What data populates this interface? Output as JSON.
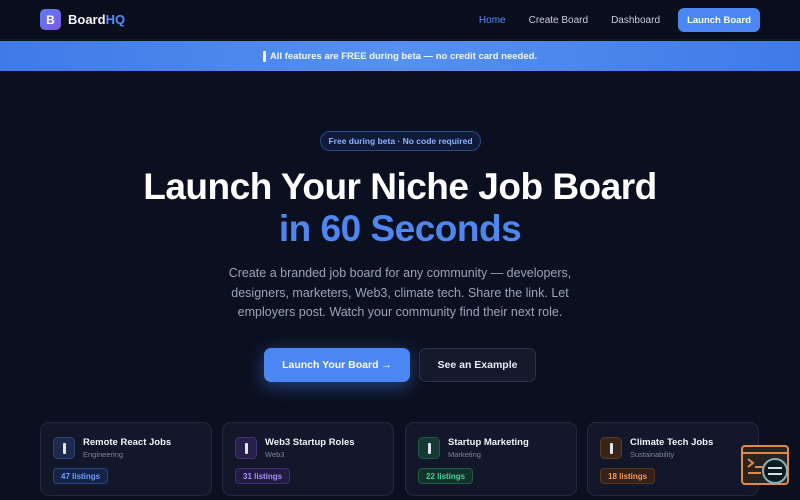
{
  "nav": {
    "logo_letter": "B",
    "brand_main": "Board",
    "brand_accent": "HQ",
    "links": [
      {
        "label": "Home",
        "active": true
      },
      {
        "label": "Create Board",
        "active": false
      },
      {
        "label": "Dashboard",
        "active": false
      }
    ],
    "cta_label": "Launch Board"
  },
  "banner": {
    "text": "All features are FREE during beta — no credit card needed."
  },
  "hero": {
    "pill": "Free during beta · No code required",
    "title_line1": "Launch Your Niche Job Board",
    "title_line2": "in 60 Seconds",
    "subtitle": "Create a branded job board for any community — developers, designers, marketers, Web3, climate tech. Share the link. Let employers post. Watch your community find their next role.",
    "primary_button": "Launch Your Board →",
    "secondary_button": "See an Example"
  },
  "cards": [
    {
      "title": "Remote React Jobs",
      "category": "Engineering",
      "listings": "47 listings",
      "color": "#4f86f0"
    },
    {
      "title": "Web3 Startup Roles",
      "category": "Web3",
      "listings": "31 listings",
      "color": "#9b6cf0"
    },
    {
      "title": "Startup Marketing",
      "category": "Marketing",
      "listings": "22 listings",
      "color": "#27c08a"
    },
    {
      "title": "Climate Tech Jobs",
      "category": "Sustainability",
      "listings": "18 listings",
      "color": "#f0883e"
    }
  ],
  "colors": {
    "background": "#0b1020",
    "accent": "#4b86f5",
    "banner": "#4a86ee"
  }
}
